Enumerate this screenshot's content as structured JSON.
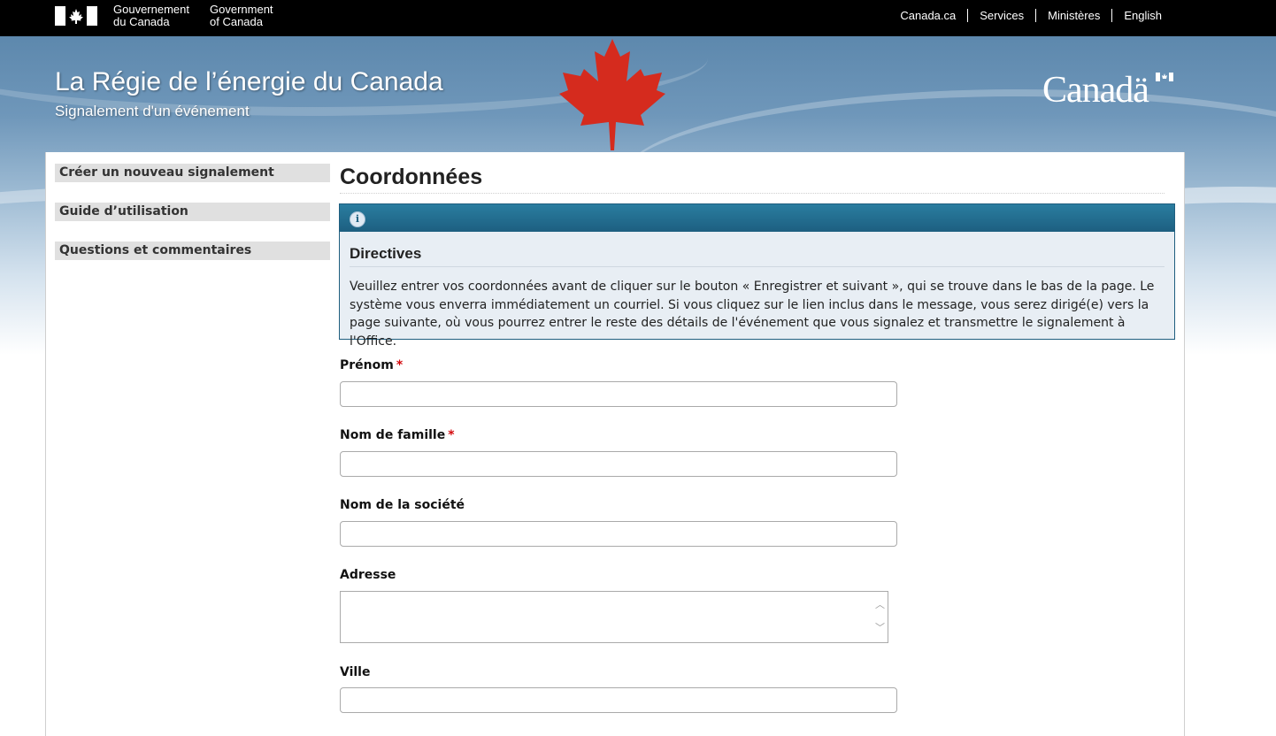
{
  "gcbar": {
    "signature_fr_line1": "Gouvernement",
    "signature_fr_line2": "du Canada",
    "signature_en_line1": "Government",
    "signature_en_line2": "of Canada",
    "links": [
      "Canada.ca",
      "Services",
      "Ministères",
      "English"
    ]
  },
  "banner": {
    "title": "La Régie de l’énergie du Canada",
    "subtitle": "Signalement d'un événement",
    "wordmark": "Canadä"
  },
  "sidenav": {
    "items": [
      "Créer un nouveau signalement",
      "Guide d’utilisation",
      "Questions et commentaires"
    ]
  },
  "main": {
    "title": "Coordonnées",
    "alert": {
      "icon": "info-icon",
      "title": "Directives",
      "text": "Veuillez entrer vos coordonnées avant de cliquer sur le bouton « Enregistrer et suivant », qui se trouve dans le bas de la page. Le système vous enverra immédiatement un courriel. Si vous cliquez sur le lien inclus dans le message, vous serez dirigé(e) vers la page suivante, où vous pourrez entrer le reste des détails de l'événement que vous signalez et transmettre le signalement à l'Office."
    },
    "fields": {
      "prenom": {
        "label": "Prénom",
        "required": "*",
        "value": ""
      },
      "nom_famille": {
        "label": "Nom de famille",
        "required": "*",
        "value": ""
      },
      "societe": {
        "label": "Nom de la société",
        "value": ""
      },
      "adresse": {
        "label": "Adresse",
        "value": ""
      },
      "ville": {
        "label": "Ville",
        "value": ""
      }
    }
  },
  "colors": {
    "required": "#d3080c",
    "alert_header": "#1d5f80",
    "leaf": "#d52b1e"
  }
}
